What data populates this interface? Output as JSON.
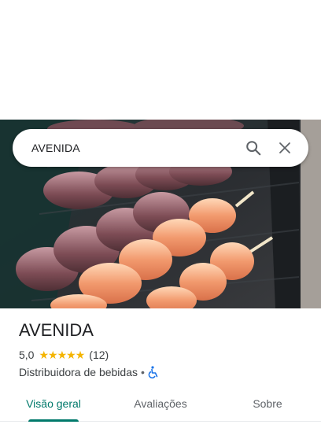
{
  "search": {
    "query": "AVENIDA"
  },
  "place": {
    "name": "AVENIDA",
    "rating": "5,0",
    "stars": 5,
    "reviews": "(12)",
    "category": "Distribuidora de bebidas",
    "separator": "•"
  },
  "tabs": [
    {
      "label": "Visão geral",
      "active": true
    },
    {
      "label": "Avaliações",
      "active": false
    },
    {
      "label": "Sobre",
      "active": false
    }
  ],
  "colors": {
    "accent": "#00796b",
    "star": "#f4b400",
    "accessibility": "#1a73e8"
  },
  "icons": {
    "search": "search-icon",
    "close": "close-icon",
    "accessibility": "wheelchair-icon"
  }
}
